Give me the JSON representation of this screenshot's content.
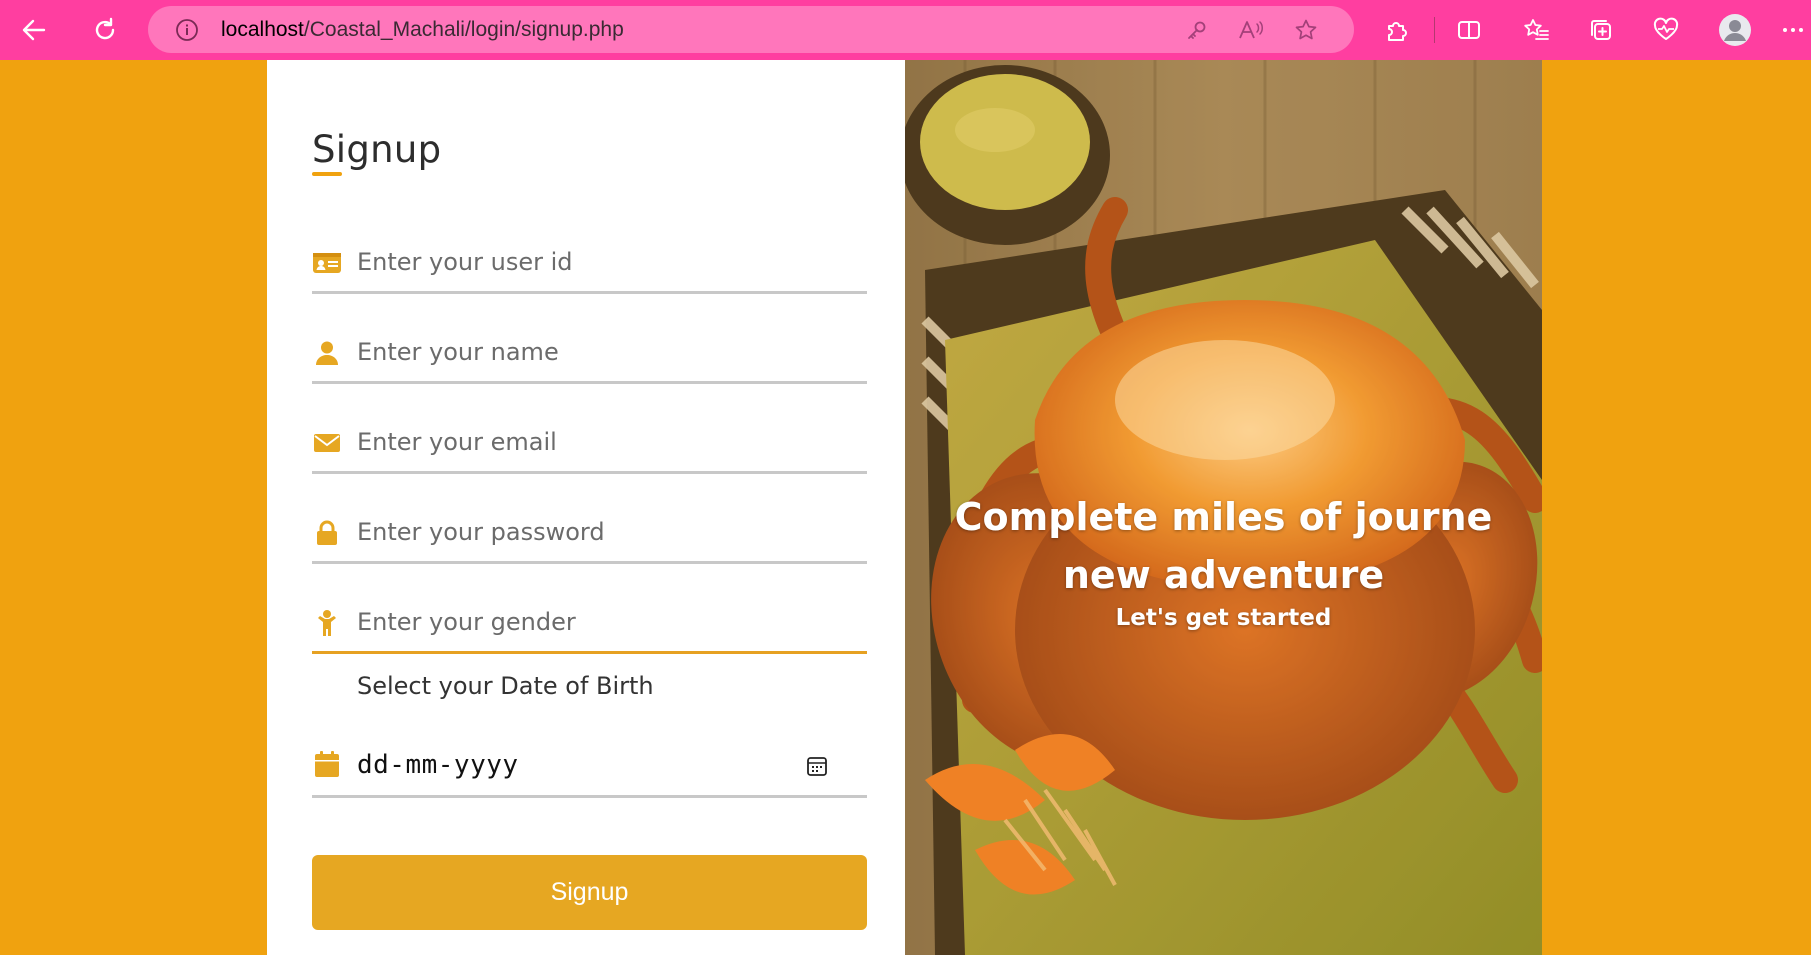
{
  "browser": {
    "url_host": "localhost",
    "url_path": "/Coastal_Machali/login/signup.php",
    "icons": [
      "back-icon",
      "refresh-icon",
      "info-icon",
      "key-icon",
      "read-aloud-icon",
      "star-icon",
      "extensions-icon",
      "split-screen-icon",
      "favorites-icon",
      "collections-icon",
      "health-icon",
      "profile-icon",
      "more-icon"
    ]
  },
  "form": {
    "title": "Signup",
    "fields": [
      {
        "icon": "id-card-icon",
        "placeholder": "Enter your user id"
      },
      {
        "icon": "user-icon",
        "placeholder": "Enter your name"
      },
      {
        "icon": "envelope-icon",
        "placeholder": "Enter your email"
      },
      {
        "icon": "lock-icon",
        "placeholder": "Enter your password"
      },
      {
        "icon": "child-icon",
        "placeholder": "Enter your gender"
      }
    ],
    "dob_label": "Select your Date of Birth",
    "dob_value": "dd-mm-yyyy",
    "submit_label": "Signup"
  },
  "hero": {
    "tagline_line1": "Complete miles of journe",
    "tagline_line2": "new adventure",
    "subtitle": "Let's get started"
  },
  "colors": {
    "page_background": "#f0a20f",
    "browser_bar": "#ff3ea0",
    "accent": "#e6a722",
    "icon": "#e6a722"
  }
}
